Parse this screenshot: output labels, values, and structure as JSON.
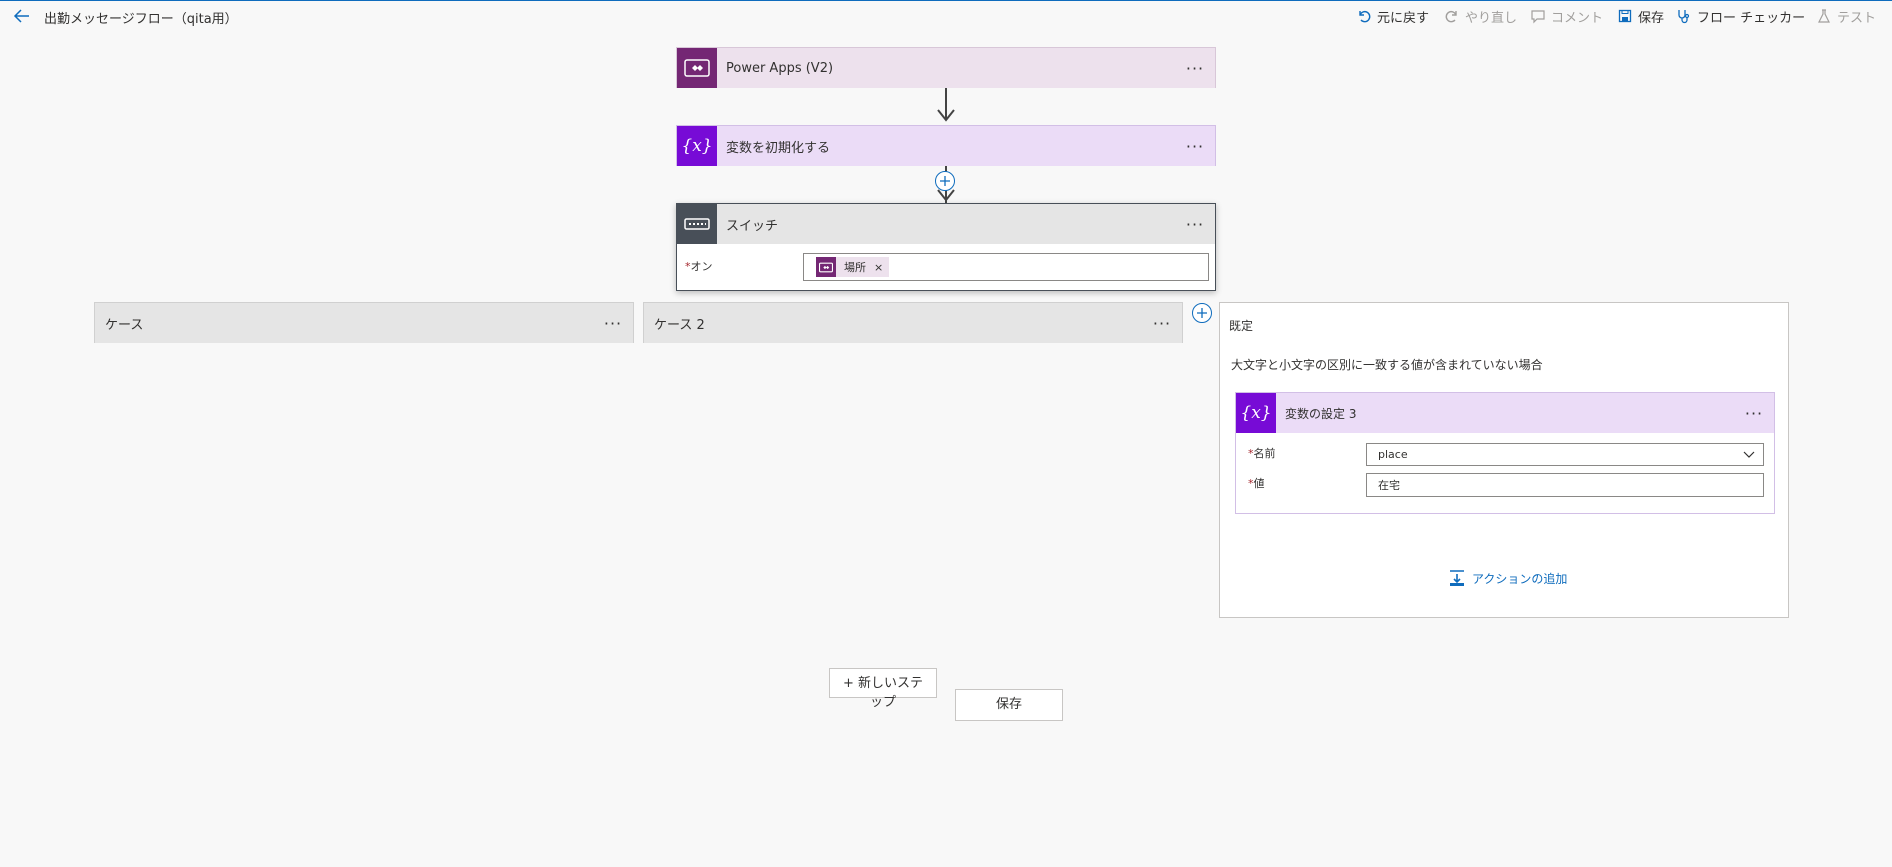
{
  "topbar": {
    "title": "出勤メッセージフロー（qita用）",
    "undo": "元に戻す",
    "redo": "やり直し",
    "comment": "コメント",
    "save": "保存",
    "flow_checker": "フロー チェッカー",
    "test": "テスト"
  },
  "colors": {
    "powerapps": "#742774",
    "powerapps_light": "#ede1ed",
    "variable": "#770bd6",
    "variable_light": "#ebdcf7",
    "switch": "#484f58",
    "switch_light": "#e5e5e5",
    "link": "#0f6cbd"
  },
  "trigger": {
    "title": "Power Apps (V2)",
    "icon": "powerapps-icon"
  },
  "init_var": {
    "title": "変数を初期化する",
    "icon": "variable-icon"
  },
  "switch": {
    "title": "スイッチ",
    "icon": "switch-icon",
    "on_label": "オン",
    "token": "場所",
    "token_remove": "×"
  },
  "cases": [
    {
      "title": "ケース"
    },
    {
      "title": "ケース 2"
    }
  ],
  "default_case": {
    "title": "既定",
    "description": "大文字と小文字の区別に一致する値が含まれていない場合",
    "action": {
      "title": "変数の設定 3",
      "name_label": "名前",
      "name_value": "place",
      "value_label": "値",
      "value_value": "在宅"
    },
    "add_action": "アクションの追加"
  },
  "footer": {
    "new_step": "+ 新しいステップ",
    "save": "保存"
  },
  "more_glyph": "···",
  "required_mark": "*"
}
